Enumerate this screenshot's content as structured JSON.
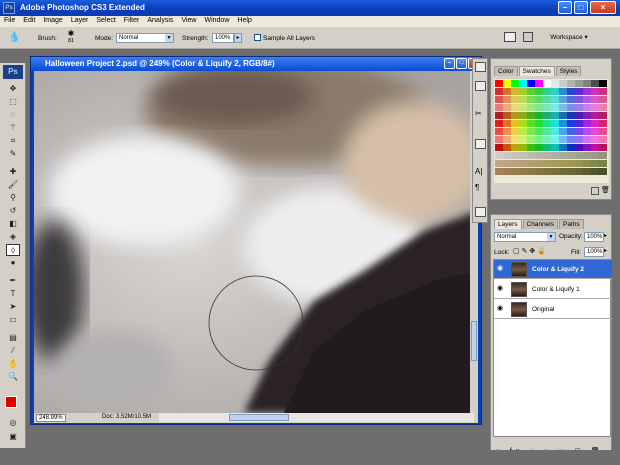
{
  "app": {
    "title": "Adobe Photoshop CS3 Extended",
    "icon_label": "Ps"
  },
  "window_controls": [
    "–",
    "□",
    "×"
  ],
  "menu": [
    "File",
    "Edit",
    "Image",
    "Layer",
    "Select",
    "Filter",
    "Analysis",
    "View",
    "Window",
    "Help"
  ],
  "options": {
    "brush_label": "Brush:",
    "brush_size": "81",
    "mode_label": "Mode:",
    "mode_value": "Normal",
    "strength_label": "Strength:",
    "strength_value": "100%",
    "sample_all_layers": "Sample All Layers",
    "workspace": "Workspace"
  },
  "document": {
    "title": "Halloween Project 2.psd @ 249% (Color & Liquify 2, RGB/8#)",
    "zoom": "248.99%",
    "doc_size": "Doc: 3.52M/10.5M"
  },
  "swatches_panel": {
    "tabs": [
      "Color",
      "Swatches",
      "Styles"
    ],
    "active_tab": "Swatches"
  },
  "layers_panel": {
    "tabs": [
      "Layers",
      "Channels",
      "Paths"
    ],
    "blend_mode": "Normal",
    "opacity_label": "Opacity:",
    "opacity_value": "100%",
    "lock_label": "Lock:",
    "fill_label": "Fill:",
    "fill_value": "100%",
    "layers": [
      {
        "name": "Color & Liquify 2",
        "active": true
      },
      {
        "name": "Color & Liquify 1",
        "active": false
      },
      {
        "name": "Original",
        "active": false
      }
    ]
  },
  "colors": {
    "foreground": "#e00000",
    "background": "#000000",
    "accent": "#3168d5"
  }
}
